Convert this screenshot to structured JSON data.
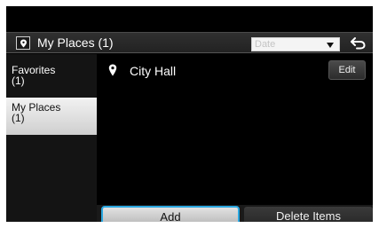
{
  "header": {
    "title": "My Places (1)",
    "date_placeholder": "Date"
  },
  "sidebar": {
    "items": [
      {
        "label": "Favorites",
        "count": "(1)",
        "active": false
      },
      {
        "label": "My Places",
        "count": "(1)",
        "active": true
      }
    ]
  },
  "places": [
    {
      "name": "City Hall",
      "action": "Edit"
    }
  ],
  "footer": {
    "add_label": "Add",
    "delete_label": "Delete Items"
  },
  "colors": {
    "accent_focus": "#2aa7e0",
    "background": "#000000",
    "active_tab": "#e6e6e6"
  },
  "icons": {
    "header": "map-pin-icon",
    "back": "back-arrow-icon",
    "list_item": "location-pin-icon"
  }
}
